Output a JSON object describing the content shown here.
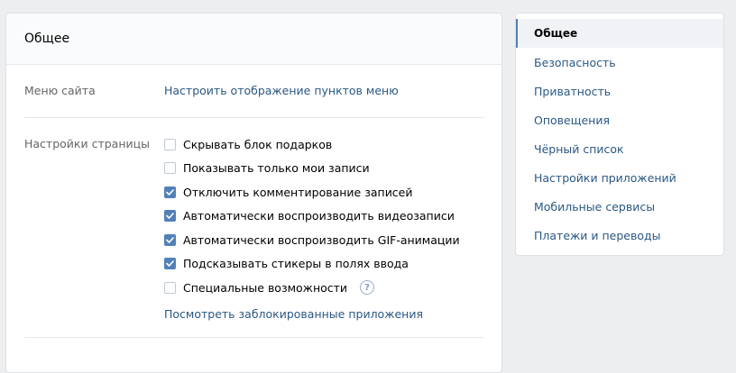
{
  "main": {
    "title": "Общее",
    "menu_label": "Меню сайта",
    "menu_link": "Настроить отображение пунктов меню",
    "page_settings_label": "Настройки страницы",
    "checkboxes": [
      {
        "label": "Скрывать блок подарков",
        "checked": false
      },
      {
        "label": "Показывать только мои записи",
        "checked": false
      },
      {
        "label": "Отключить комментирование записей",
        "checked": true
      },
      {
        "label": "Автоматически воспроизводить видеозаписи",
        "checked": true
      },
      {
        "label": "Автоматически воспроизводить GIF-анимации",
        "checked": true
      },
      {
        "label": "Подсказывать стикеры в полях ввода",
        "checked": true
      },
      {
        "label": "Специальные возможности",
        "checked": false
      }
    ],
    "help_icon_text": "?",
    "blocked_apps_link": "Посмотреть заблокированные приложения"
  },
  "sidebar": {
    "items": [
      {
        "label": "Общее",
        "active": true
      },
      {
        "label": "Безопасность",
        "active": false
      },
      {
        "label": "Приватность",
        "active": false
      },
      {
        "label": "Оповещения",
        "active": false
      },
      {
        "label": "Чёрный список",
        "active": false
      },
      {
        "label": "Настройки приложений",
        "active": false
      },
      {
        "label": "Мобильные сервисы",
        "active": false
      },
      {
        "label": "Платежи и переводы",
        "active": false
      }
    ]
  },
  "colors": {
    "accent": "#5181b8",
    "link": "#2a5885",
    "background": "#edeef0"
  }
}
